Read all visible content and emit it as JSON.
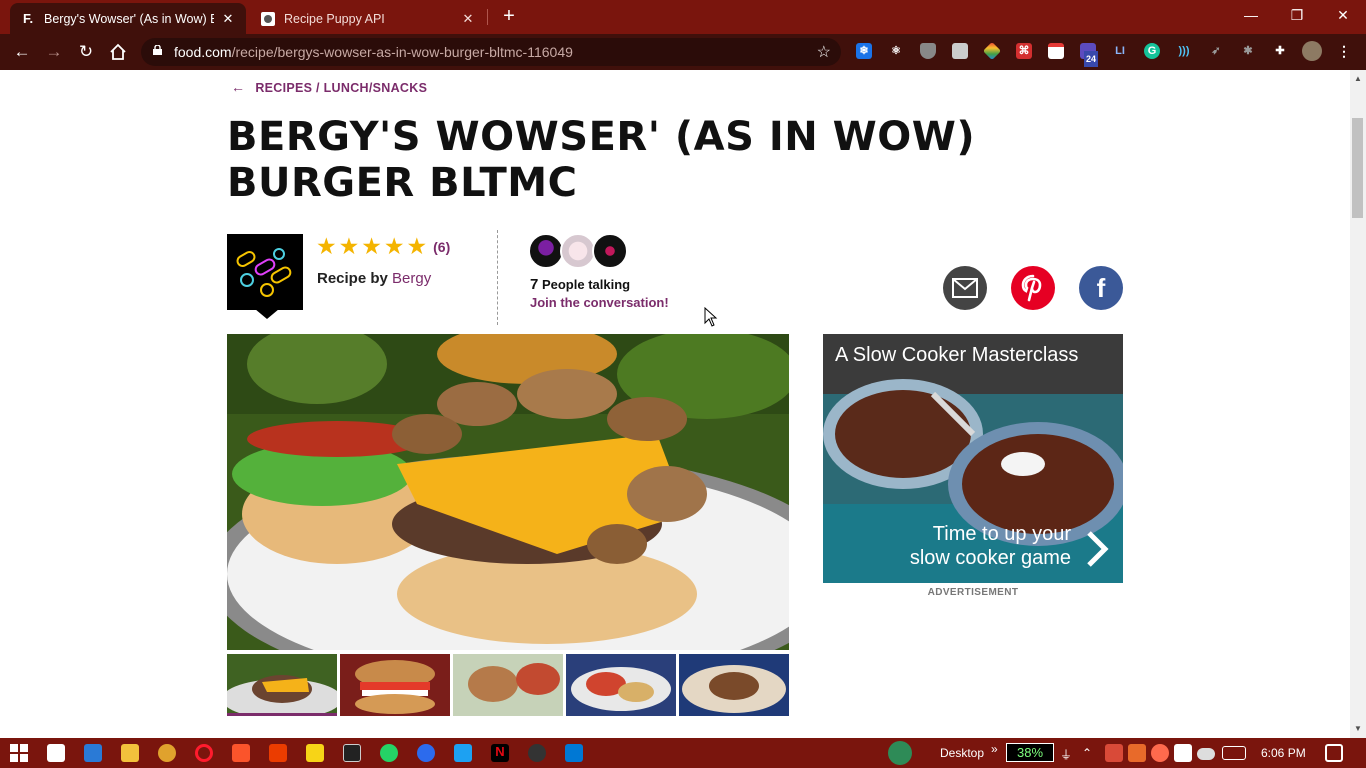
{
  "browser": {
    "tabs": [
      {
        "title": "Bergy's Wowser' (As in Wow) Bur",
        "favicon": "F.",
        "active": true
      },
      {
        "title": "Recipe Puppy API",
        "favicon": "",
        "active": false
      }
    ],
    "url_host": "food.com",
    "url_path": "/recipe/bergys-wowser-as-in-wow-burger-bltmc-116049",
    "extension_badge": "24",
    "extension_li": "LI",
    "extension_g": "G"
  },
  "page": {
    "breadcrumb": "RECIPES / LUNCH/SNACKS",
    "title": "BERGY'S WOWSER' (AS IN WOW) BURGER BLTMC",
    "rating": {
      "stars": 5,
      "max": 5,
      "count": "(6)"
    },
    "recipe_by_prefix": "Recipe by",
    "author": "Bergy",
    "talking_count": "7",
    "talking_label": "People talking",
    "join_text": "Join the conversation!"
  },
  "ad": {
    "title": "A Slow Cooker Masterclass",
    "tagline_line1": "Time to up your",
    "tagline_line2": "slow cooker game",
    "label": "ADVERTISEMENT"
  },
  "taskbar": {
    "desktop_label": "Desktop",
    "battery": "38%",
    "time": "6:06 PM"
  },
  "colors": {
    "brand": "#7b2c6b",
    "star": "#f4b400",
    "chrome_frame": "#7a150d",
    "chrome_toolbar": "#40100b"
  }
}
